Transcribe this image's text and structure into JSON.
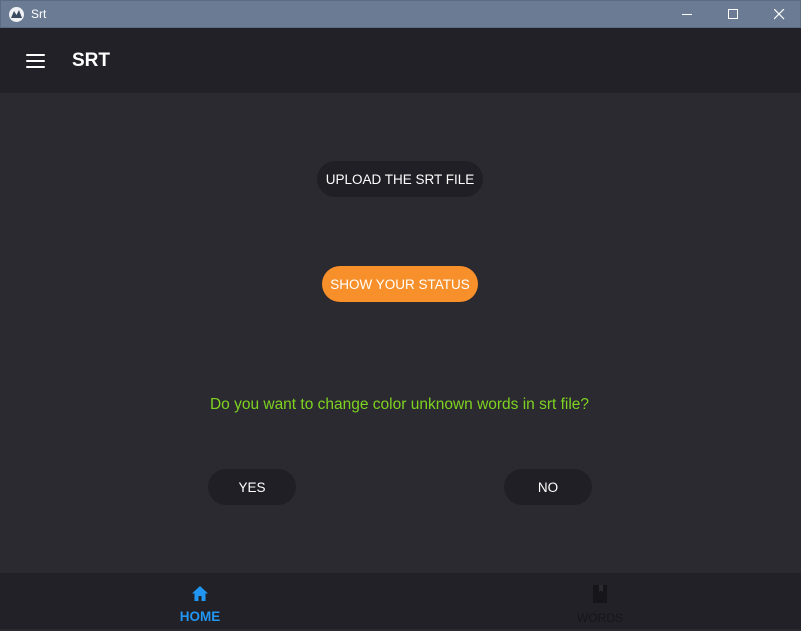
{
  "window": {
    "title": "Srt",
    "icons": {
      "app": "kivy-logo-icon",
      "minimize": "minimize-icon",
      "maximize": "maximize-icon",
      "close": "close-icon"
    }
  },
  "appbar": {
    "title": "SRT",
    "menu_icon": "hamburger-menu-icon"
  },
  "main": {
    "upload_button": "UPLOAD THE SRT FILE",
    "status_button": "SHOW YOUR STATUS",
    "question": "Do you want to change color unknown words in srt file?",
    "yes_button": "YES",
    "no_button": "NO"
  },
  "bottom_nav": {
    "items": [
      {
        "label": "HOME",
        "icon": "home-icon",
        "active": true
      },
      {
        "label": "WORDS",
        "icon": "book-icon",
        "active": false
      }
    ]
  },
  "colors": {
    "background": "#2b2a30",
    "bar": "#212127",
    "accent_orange": "#f7902a",
    "question_green": "#7ed321",
    "active_blue": "#2196f3",
    "titlebar": "#6a7b93"
  }
}
